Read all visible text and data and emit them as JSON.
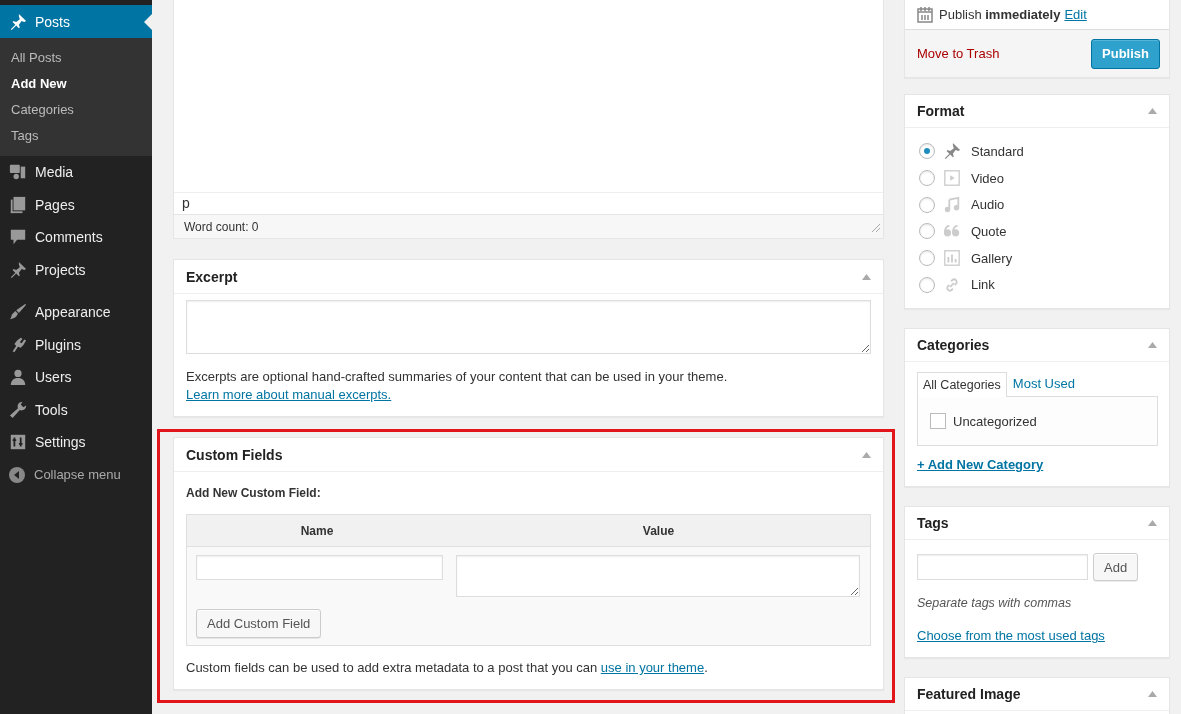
{
  "sidebar": {
    "menu_groups": [
      {
        "items": [
          {
            "label": "Posts",
            "selected": true,
            "submenu": [
              {
                "label": "All Posts",
                "selected": false
              },
              {
                "label": "Add New",
                "selected": true
              },
              {
                "label": "Categories",
                "selected": false
              },
              {
                "label": "Tags",
                "selected": false
              }
            ]
          },
          {
            "label": "Media",
            "selected": false
          },
          {
            "label": "Pages",
            "selected": false
          },
          {
            "label": "Comments",
            "selected": false
          },
          {
            "label": "Projects",
            "selected": false
          }
        ]
      },
      {
        "items": [
          {
            "label": "Appearance",
            "selected": false
          },
          {
            "label": "Plugins",
            "selected": false
          },
          {
            "label": "Users",
            "selected": false
          },
          {
            "label": "Tools",
            "selected": false
          },
          {
            "label": "Settings",
            "selected": false
          }
        ]
      }
    ],
    "collapse": "Collapse menu"
  },
  "editor": {
    "path": "p",
    "word_count": "Word count: 0"
  },
  "excerpt": {
    "title": "Excerpt",
    "help_text": "Excerpts are optional hand-crafted summaries of your content that can be used in your theme.",
    "help_link": "Learn more about manual excerpts."
  },
  "custom_fields": {
    "title": "Custom Fields",
    "subtitle": "Add New Custom Field:",
    "columns": [
      "Name",
      "Value"
    ],
    "add_button": "Add Custom Field",
    "help_text": "Custom fields can be used to add extra metadata to a post that you can",
    "help_link": "use in your theme",
    "help_end": "."
  },
  "publish": {
    "schedule": "Publish **immediately**",
    "edit_link": "Edit",
    "trash_link": "Move to Trash",
    "publish_button": "Publish"
  },
  "format": {
    "title": "Format",
    "options": [
      {
        "label": "Standard",
        "selected": true
      },
      {
        "label": "Video",
        "selected": false
      },
      {
        "label": "Audio",
        "selected": false
      },
      {
        "label": "Quote",
        "selected": false
      },
      {
        "label": "Gallery",
        "selected": false
      },
      {
        "label": "Link",
        "selected": false
      }
    ]
  },
  "categories": {
    "title": "Categories",
    "tabs": [
      {
        "label": "All Categories",
        "selected": true
      },
      {
        "label": "Most Used",
        "selected": false
      }
    ],
    "items": [
      {
        "label": "Uncategorized",
        "checked": false
      }
    ],
    "add_link": "+ Add New Category"
  },
  "tags": {
    "title": "Tags",
    "add_button": "Add",
    "hint": "Separate tags with commas",
    "choose_link": "Choose from the most used tags"
  },
  "featured_image": {
    "title": "Featured Image"
  }
}
